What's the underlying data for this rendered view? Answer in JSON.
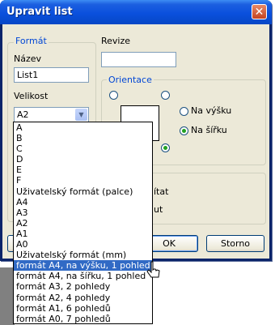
{
  "dialog": {
    "title": "Upravit list",
    "close_glyph": "✕"
  },
  "format_group": {
    "title": "Formát",
    "name_label": "Název",
    "name_value": "List1",
    "size_label": "Velikost",
    "size_value": "A2"
  },
  "revision": {
    "label": "Revize",
    "value": ""
  },
  "orientation_group": {
    "title": "Orientace",
    "portrait_label": "Na výšku",
    "landscape_label": "Na šířku",
    "selected": "Na šířku"
  },
  "options_group": {
    "partial_text_1": "ítat",
    "partial_text_2": "ut"
  },
  "buttons": {
    "ok": "OK",
    "cancel": "Storno"
  },
  "size_dropdown": {
    "options": [
      "A",
      "B",
      "C",
      "D",
      "E",
      "F",
      "Uživatelský formát (palce)",
      "A4",
      "A3",
      "A2",
      "A1",
      "A0",
      "Uživatelský formát (mm)",
      "formát A4, na výšku, 1 pohled",
      "formát A4, na šířku, 1 pohled",
      "formát A3, 2 pohledy",
      "formát A2, 4 pohledy",
      "formát A1, 6 pohledů",
      "formát A0, 7 pohledů"
    ],
    "highlighted": "formát A4, na výšku, 1 pohled"
  },
  "colors": {
    "titlebar": "#0a50dd",
    "dialog_bg": "#ece9d8",
    "group_title": "#0046d5",
    "selection": "#316ac5"
  },
  "icons": {
    "close": "close-icon",
    "combo_arrow": "chevron-down-icon",
    "pointer": "mouse-cursor-icon"
  }
}
